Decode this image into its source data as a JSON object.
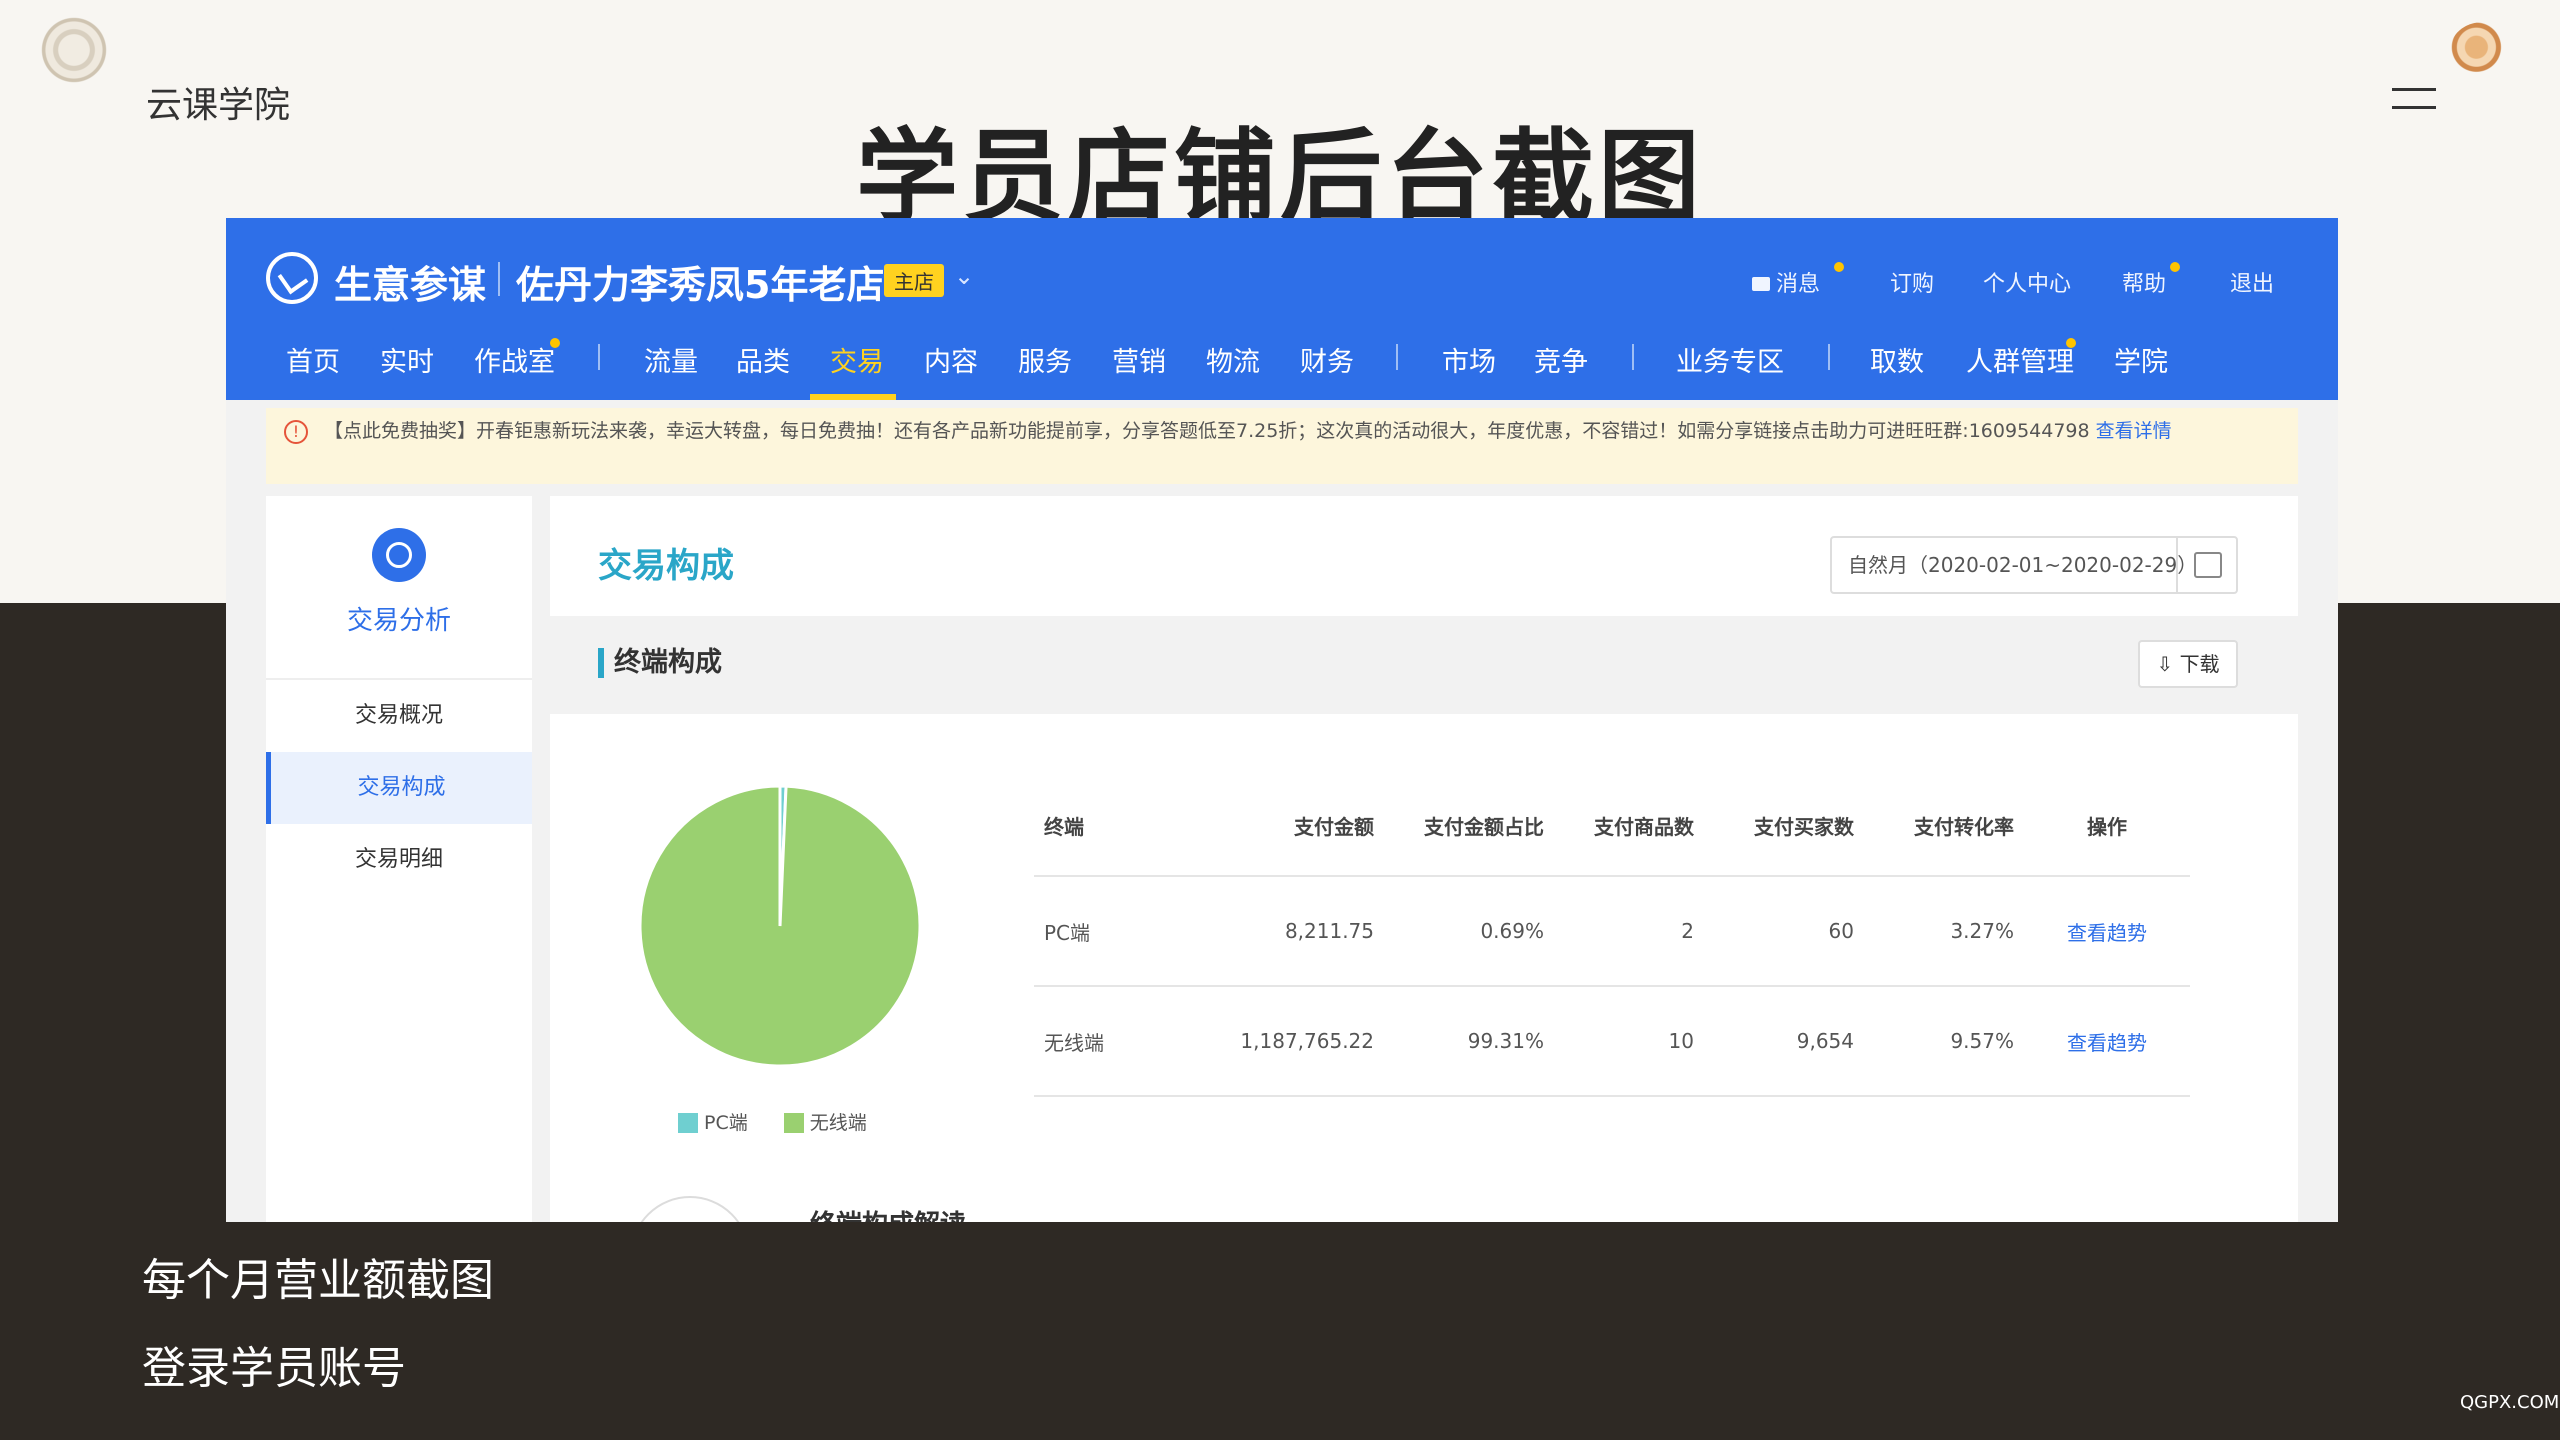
{
  "brand": "云课学院",
  "headline": "学员店铺后台截图",
  "app": {
    "name": "生意参谋",
    "shop": "佐丹力李秀凤5年老店",
    "badge": "主店",
    "top_links": [
      "消息",
      "订购",
      "个人中心",
      "帮助",
      "退出"
    ],
    "nav": [
      "首页",
      "实时",
      "作战室",
      "流量",
      "品类",
      "交易",
      "内容",
      "服务",
      "营销",
      "物流",
      "财务",
      "市场",
      "竞争",
      "业务专区",
      "取数",
      "人群管理",
      "学院"
    ],
    "active_nav": "交易"
  },
  "notice": {
    "text": "【点此免费抽奖】开春钜惠新玩法来袭，幸运大转盘，每日免费抽！还有各产品新功能提前享，分享答题低至7.25折；这次真的活动很大，年度优惠，不容错过！如需分享链接点击助力可进旺旺群:1609544798",
    "link": "查看详情"
  },
  "sidebar": {
    "title": "交易分析",
    "items": [
      "交易概况",
      "交易构成",
      "交易明细"
    ],
    "active": "交易构成"
  },
  "main": {
    "title": "交易构成",
    "date_range": "自然月（2020-02-01~2020-02-29）",
    "section_title": "终端构成",
    "download": "下载",
    "analysis_title": "终端构成解读"
  },
  "table": {
    "headers": [
      "终端",
      "支付金额",
      "支付金额占比",
      "支付商品数",
      "支付买家数",
      "支付转化率",
      "操作"
    ],
    "rows": [
      [
        "PC端",
        "8,211.75",
        "0.69%",
        "2",
        "60",
        "3.27%",
        "查看趋势"
      ],
      [
        "无线端",
        "1,187,765.22",
        "99.31%",
        "10",
        "9,654",
        "9.57%",
        "查看趋势"
      ]
    ]
  },
  "chart_data": {
    "type": "pie",
    "categories": [
      "PC端",
      "无线端"
    ],
    "values": [
      0.69,
      99.31
    ],
    "colors": [
      "#6fcfd0",
      "#9ad070"
    ]
  },
  "captions": [
    "每个月营业额截图",
    "登录学员账号"
  ],
  "watermark": "QGPX.COM"
}
